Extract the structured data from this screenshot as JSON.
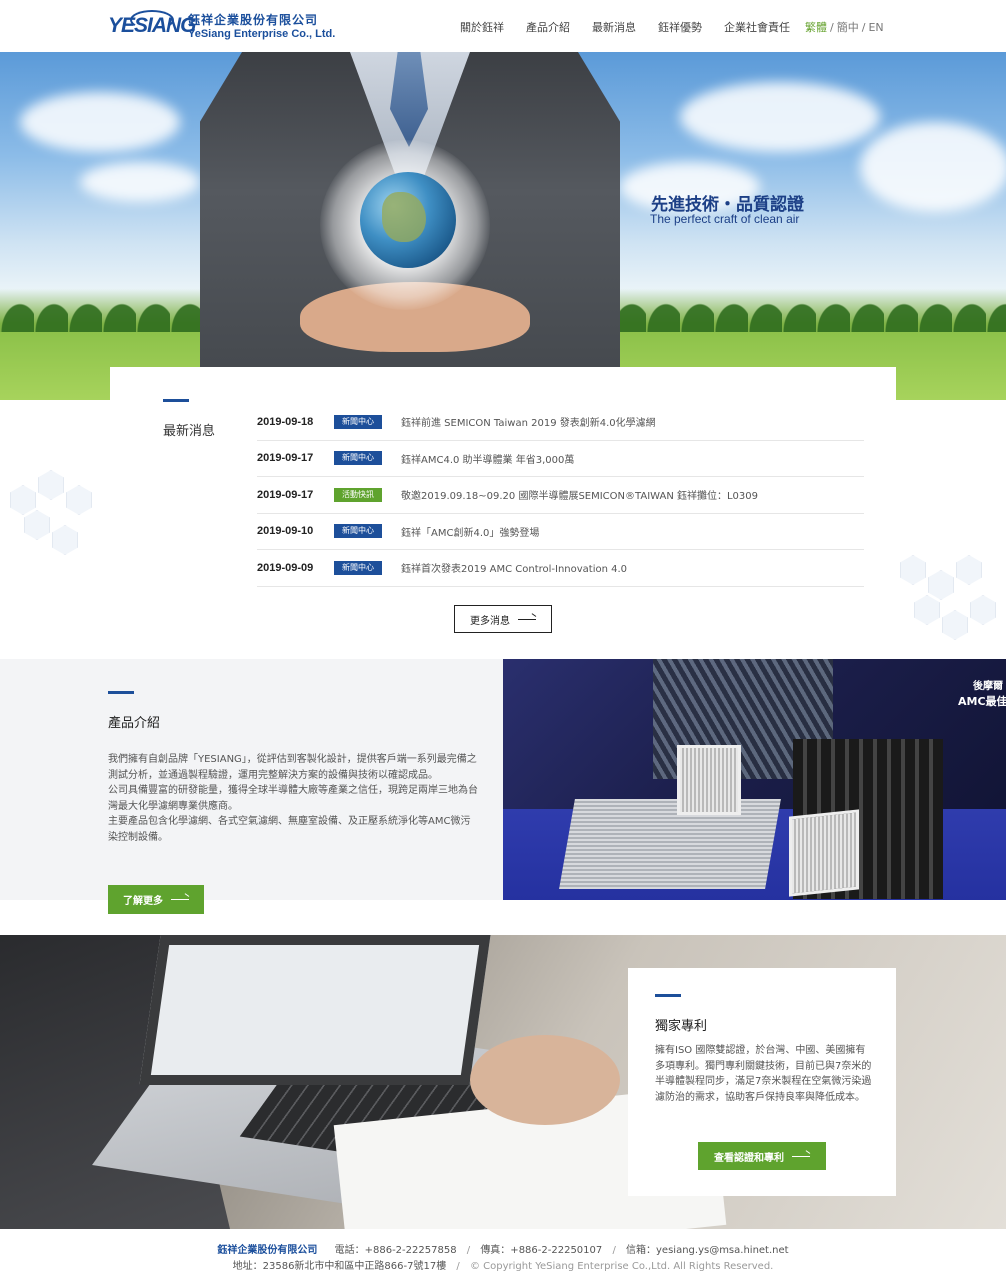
{
  "header": {
    "logo_mark": "YESIANG",
    "company_cn": "鈺祥企業股份有限公司",
    "company_en": "YeSiang Enterprise Co., Ltd.",
    "nav": [
      "關於鈺祥",
      "產品介紹",
      "最新消息",
      "鈺祥優勢",
      "企業社會責任"
    ],
    "lang": [
      "繁體",
      "簡中",
      "EN"
    ],
    "lang_active": "繁體"
  },
  "hero": {
    "title": "先進技術・品質認證",
    "subtitle": "The perfect craft of clean air"
  },
  "news": {
    "label": "最新消息",
    "items": [
      {
        "date": "2019-09-18",
        "tag": "新聞中心",
        "tag_color": "#1d4f9a",
        "title": "鈺祥前進 SEMICON Taiwan 2019 發表創新4.0化學濾網"
      },
      {
        "date": "2019-09-17",
        "tag": "新聞中心",
        "tag_color": "#1d4f9a",
        "title": "鈺祥AMC4.0 助半導體業 年省3,000萬"
      },
      {
        "date": "2019-09-17",
        "tag": "活動快訊",
        "tag_color": "#5fa32e",
        "title": "敬邀2019.09.18~09.20 國際半導體展SEMICON®TAIWAN 鈺祥攤位：L0309"
      },
      {
        "date": "2019-09-10",
        "tag": "新聞中心",
        "tag_color": "#1d4f9a",
        "title": "鈺祥「AMC創新4.0」強勢登場"
      },
      {
        "date": "2019-09-09",
        "tag": "新聞中心",
        "tag_color": "#1d4f9a",
        "title": "鈺祥首次發表2019 AMC Control-Innovation 4.0"
      }
    ],
    "more_label": "更多消息"
  },
  "product": {
    "title": "產品介紹",
    "body": "我們擁有自創品牌「YESIANG」，從評估到客製化設計，提供客戶端一系列最完備之測試分析，並通過製程驗證，運用完整解決方案的設備與技術以確認成品。\n公司具備豐富的研發能量，獲得全球半導體大廠等產業之信任，現跨足兩岸三地為台灣最大化學濾網專業供應商。\n主要產品包含化學濾網、各式空氣濾網、無塵室設備、及正壓系統淨化等AMC微污染控制設備。",
    "button": "了解更多",
    "image_sign_1": "後摩爾",
    "image_sign_2": "AMC最佳"
  },
  "patent": {
    "title": "獨家專利",
    "body": "擁有ISO 國際雙認證，於台灣、中國、美國擁有多項專利。獨門專利關鍵技術，目前已與7奈米的半導體製程同步，滿足7奈米製程在空氣微污染過濾防治的需求，協助客戶保持良率與降低成本。",
    "button": "查看認證和專利"
  },
  "footer": {
    "company": "鈺祥企業股份有限公司",
    "phone": "電話：+886-2-22257858",
    "fax": "傳真：+886-2-22250107",
    "email": "信箱：yesiang.ys@msa.hinet.net",
    "address": "地址：23586新北市中和區中正路866-7號17樓",
    "copyright": "© Copyright YeSiang Enterprise Co.,Ltd. All Rights Reserved."
  }
}
